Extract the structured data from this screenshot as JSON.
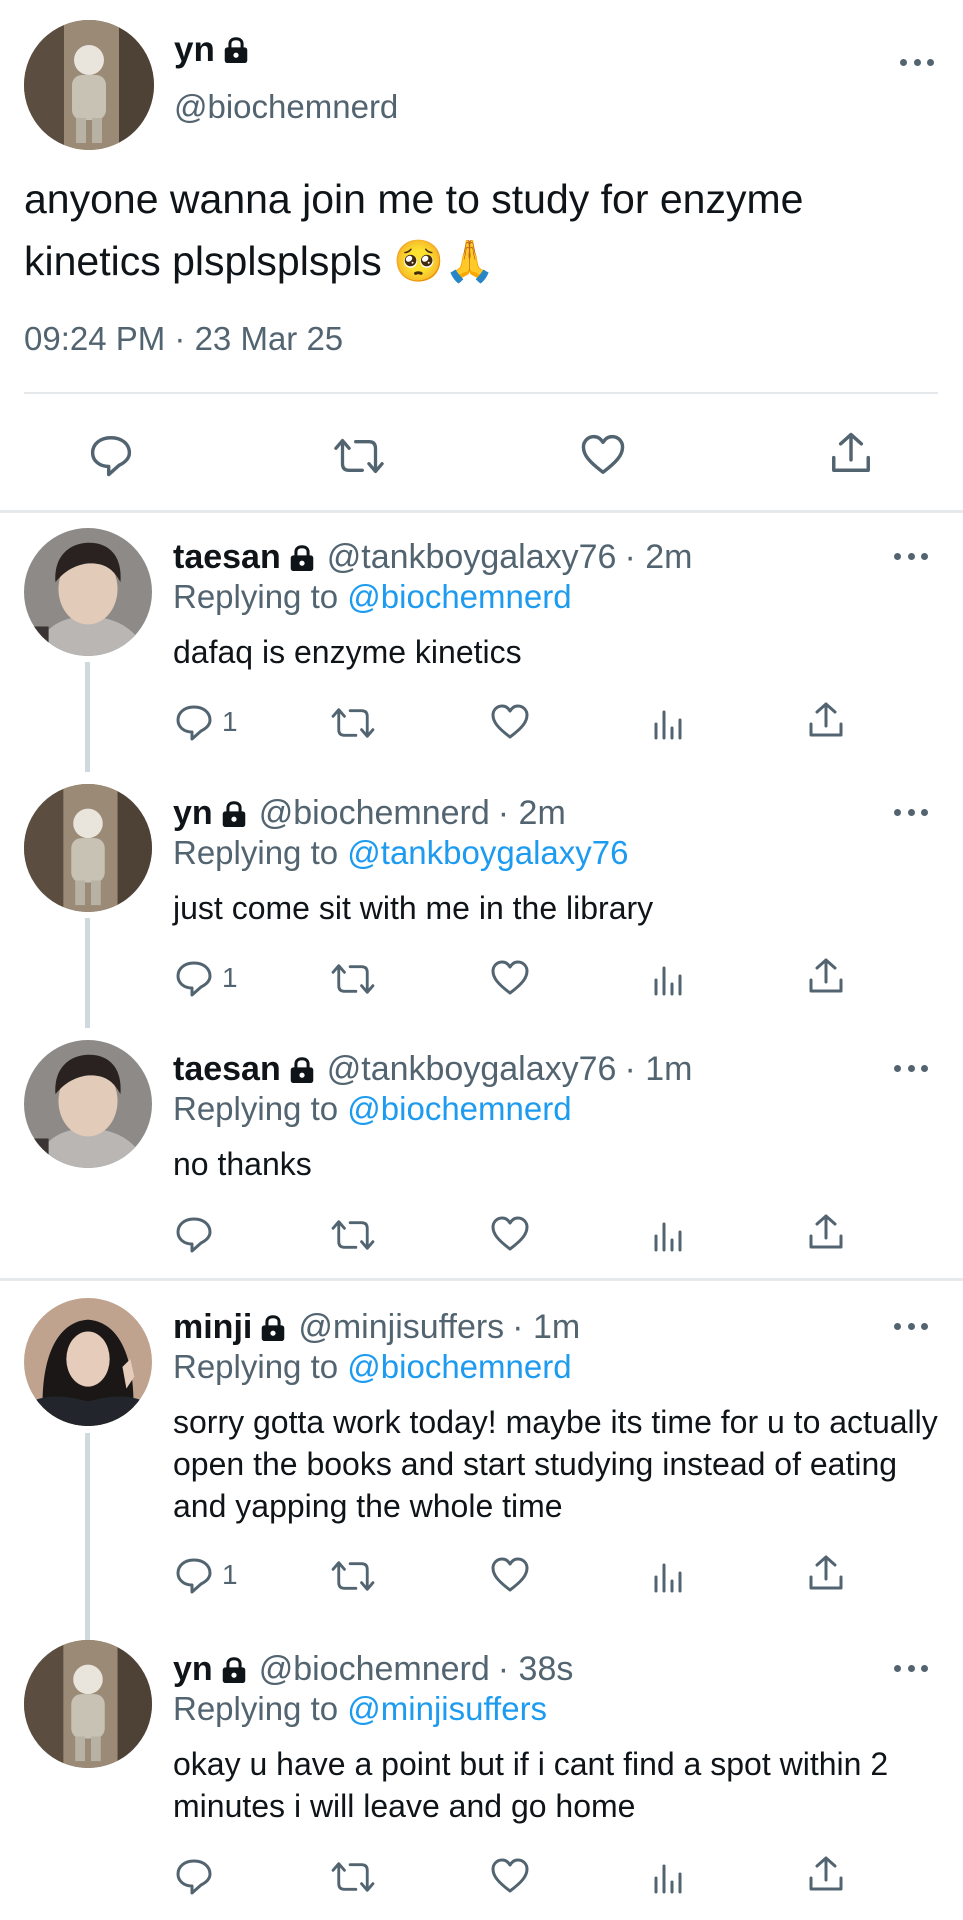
{
  "main_tweet": {
    "name": "yn",
    "handle": "@biochemnerd",
    "text": "anyone wanna join me to study for enzyme kinetics plsplsplspls 🥺🙏",
    "timestamp": "09:24 PM · 23 Mar 25"
  },
  "replies": [
    {
      "name": "taesan",
      "handle": "@tankboygalaxy76",
      "time": "· 2m",
      "replying_label": "Replying to",
      "replying_to": "@biochemnerd",
      "text": "dafaq is enzyme kinetics",
      "reply_count": "1"
    },
    {
      "name": "yn",
      "handle": "@biochemnerd",
      "time": "· 2m",
      "replying_label": "Replying to",
      "replying_to": "@tankboygalaxy76",
      "text": "just come sit with me in the library",
      "reply_count": "1"
    },
    {
      "name": "taesan",
      "handle": "@tankboygalaxy76",
      "time": "· 1m",
      "replying_label": "Replying to",
      "replying_to": "@biochemnerd",
      "text": "no thanks",
      "reply_count": ""
    },
    {
      "name": "minji",
      "handle": "@minjisuffers",
      "time": "· 1m",
      "replying_label": "Replying to",
      "replying_to": "@biochemnerd",
      "text": "sorry gotta work today! maybe its time for u to actually open the books and start studying instead of eating and yapping the whole time",
      "reply_count": "1"
    },
    {
      "name": "yn",
      "handle": "@biochemnerd",
      "time": "· 38s",
      "replying_label": "Replying to",
      "replying_to": "@minjisuffers",
      "text": "okay u have a point but if i cant find a spot within 2 minutes i will leave and go home",
      "reply_count": ""
    }
  ],
  "colors": {
    "accent": "#1d9bf0",
    "secondary_text": "#536471",
    "divider": "#e6e9eb"
  },
  "icons": [
    "lock-icon",
    "more-icon",
    "reply-icon",
    "retweet-icon",
    "like-icon",
    "views-icon",
    "share-icon"
  ]
}
